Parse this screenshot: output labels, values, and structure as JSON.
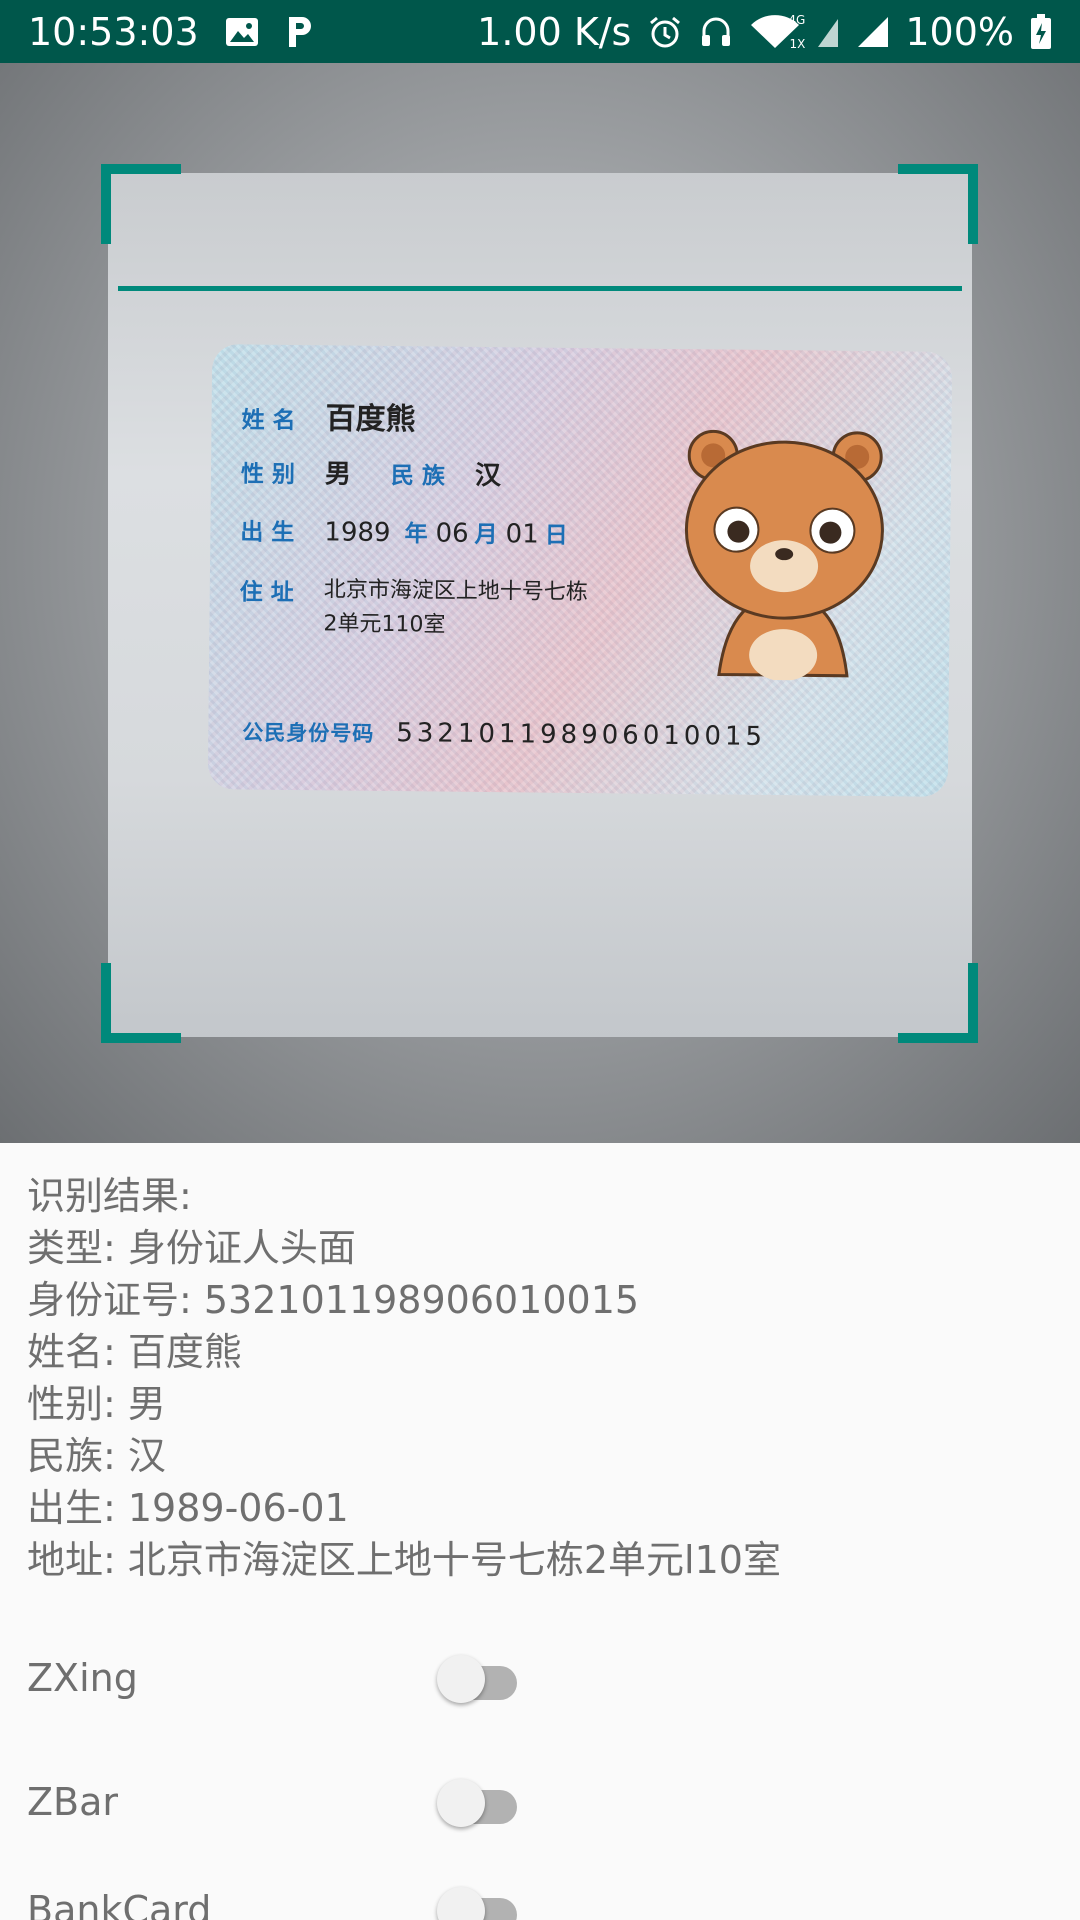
{
  "status_bar": {
    "time": "10:53:03",
    "net_speed": "1.00 K/s",
    "signal_badge": "4G",
    "signal_badge2": "1X",
    "battery": "100%",
    "icons": [
      "image-icon",
      "p-app-icon",
      "alarm-icon",
      "headphones-icon",
      "wifi-icon",
      "cell-signal-icon",
      "cell-signal-icon",
      "battery-charging-icon"
    ]
  },
  "id_card": {
    "name_label": "姓名",
    "name_value": "百度熊",
    "gender_label": "性别",
    "gender_value": "男",
    "ethnicity_label": "民族",
    "ethnicity_value": "汉",
    "birth_label": "出生",
    "birth_year": "1989",
    "birth_year_unit": "年",
    "birth_month": "06",
    "birth_month_unit": "月",
    "birth_day": "01",
    "birth_day_unit": "日",
    "address_label": "住址",
    "address_line1": "北京市海淀区上地十号七栋",
    "address_line2": "2单元110室",
    "id_label": "公民身份号码",
    "id_number": "532101198906010015"
  },
  "results": {
    "heading": "识别结果:",
    "type": "类型:  身份证人头面",
    "id_number": "身份证号:  532101198906010015",
    "name": "姓名:  百度熊",
    "gender": "性别:  男",
    "ethnicity": "民族:  汉",
    "birth": "出生:  1989-06-01",
    "address": "地址:  北京市海淀区上地十号七栋2单元l10室"
  },
  "switches": {
    "zxing_label": "ZXing",
    "zbar_label": "ZBar",
    "bankcard_label": "BankCard",
    "zxing_on": false,
    "zbar_on": false,
    "bankcard_on": false
  },
  "colors": {
    "status_bar": "#00574b",
    "scan_accent": "#00897b",
    "result_text": "#6f6f6f"
  }
}
